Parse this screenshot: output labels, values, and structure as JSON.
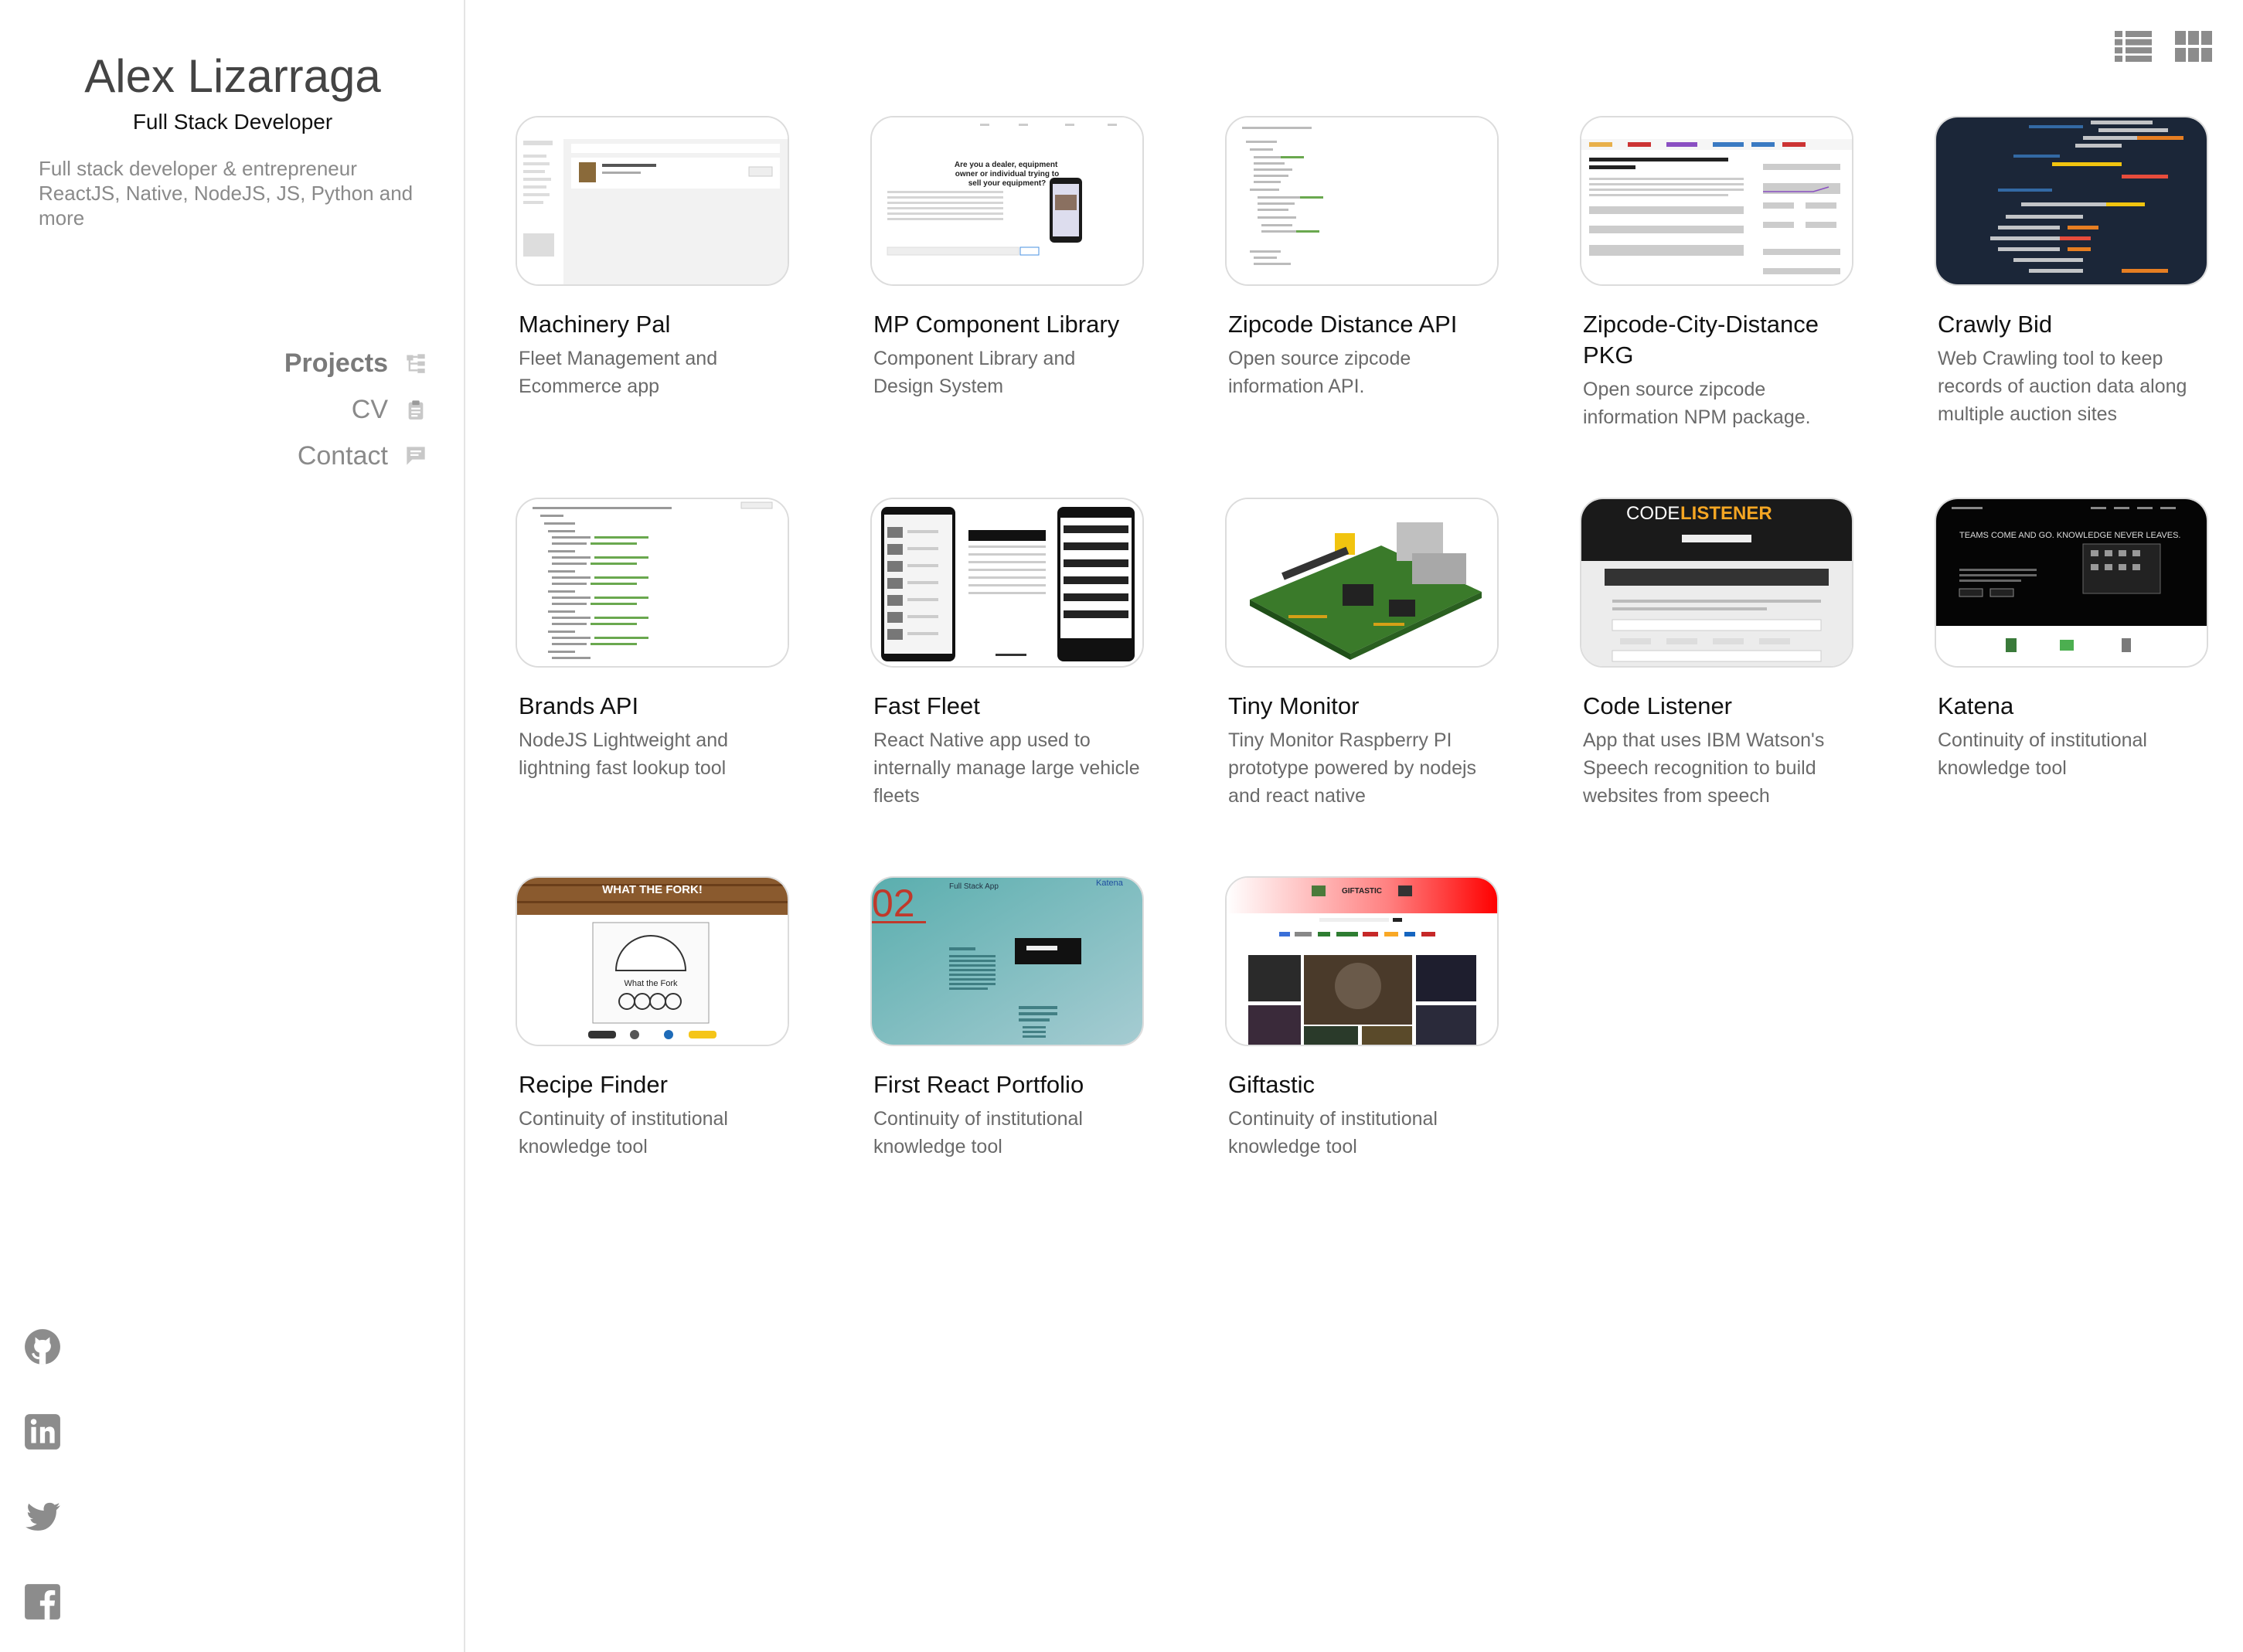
{
  "sidebar": {
    "name": "Alex Lizarraga",
    "role": "Full Stack Developer",
    "bio_lines": [
      "Full stack developer & entrepreneur",
      "ReactJS, Native, NodeJS, JS, Python and",
      "more"
    ],
    "nav": [
      {
        "label": "Projects",
        "icon": "tree-icon",
        "active": true
      },
      {
        "label": "CV",
        "icon": "clipboard-icon",
        "active": false
      },
      {
        "label": "Contact",
        "icon": "chat-icon",
        "active": false
      }
    ],
    "social": [
      "github-icon",
      "linkedin-icon",
      "twitter-icon",
      "facebook-icon"
    ]
  },
  "view_toggle": [
    "list-view-icon",
    "grid-view-icon"
  ],
  "projects": [
    {
      "title": "Machinery Pal",
      "desc": "Fleet Management and Ecommerce app"
    },
    {
      "title": "MP Component Library",
      "desc": "Component Library and Design System"
    },
    {
      "title": "Zipcode Distance API",
      "desc": "Open source zipcode information API."
    },
    {
      "title": "Zipcode-City-Distance PKG",
      "desc": "Open source zipcode information NPM package."
    },
    {
      "title": "Crawly Bid",
      "desc": "Web Crawling tool to keep records of auction data along multiple auction sites"
    },
    {
      "title": "Brands API",
      "desc": "NodeJS Lightweight and lightning fast lookup tool"
    },
    {
      "title": "Fast Fleet",
      "desc": "React Native app used to internally manage large vehicle fleets"
    },
    {
      "title": "Tiny Monitor",
      "desc": "Tiny Monitor Raspberry PI prototype powered by nodejs and react native"
    },
    {
      "title": "Code Listener",
      "desc": "App that uses IBM Watson's Speech recognition to build websites from speech"
    },
    {
      "title": "Katena",
      "desc": "Continuity of institutional knowledge tool"
    },
    {
      "title": "Recipe Finder",
      "desc": "Continuity of institutional knowledge tool"
    },
    {
      "title": "First React Portfolio",
      "desc": "Continuity of institutional knowledge tool"
    },
    {
      "title": "Giftastic",
      "desc": "Continuity of institutional knowledge tool"
    }
  ],
  "thumb_text": {
    "mp": "Are you a dealer, equipment owner or individual trying to sell your equipment?",
    "codelistener_a": "CODE",
    "codelistener_b": "LISTENER",
    "katena": "TEAMS COME AND GO. KNOWLEDGE NEVER LEAVES.",
    "recipe_banner": "WHAT THE FORK!",
    "recipe_logo": "What the Fork",
    "portfolio_app": "Full Stack App",
    "portfolio_num": "02",
    "portfolio_name": "Katena",
    "giftastic": "GIFTASTIC"
  }
}
